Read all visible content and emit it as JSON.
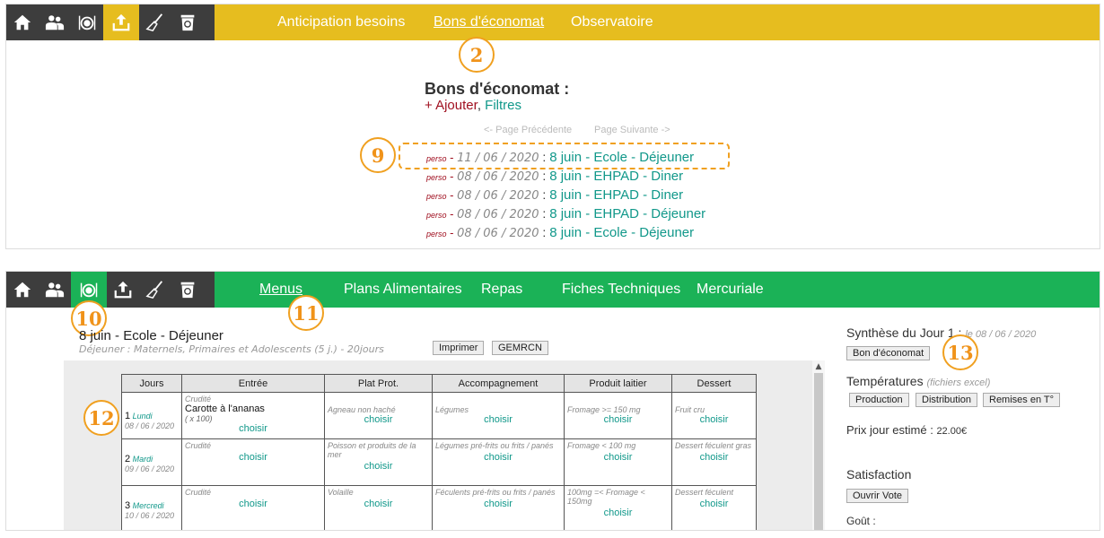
{
  "panel1": {
    "nav_links": [
      "Anticipation besoins",
      "Bons d'économat",
      "Observatoire"
    ],
    "heading": "Bons d'économat :",
    "add_label": "+ Ajouter",
    "comma": ",",
    "filters_label": "Filtres",
    "prev_page": "<- Page Précédente",
    "next_page": "Page Suivante ->",
    "bons": [
      {
        "tag": "perso",
        "date": "11 / 06 / 2020",
        "title": "8 juin - Ecole - Déjeuner"
      },
      {
        "tag": "perso",
        "date": "08 / 06 / 2020",
        "title": "8 juin - EHPAD - Diner"
      },
      {
        "tag": "perso",
        "date": "08 / 06 / 2020",
        "title": "8 juin - EHPAD - Diner"
      },
      {
        "tag": "perso",
        "date": "08 / 06 / 2020",
        "title": "8 juin - EHPAD - Déjeuner"
      },
      {
        "tag": "perso",
        "date": "08 / 06 / 2020",
        "title": "8 juin - Ecole - Déjeuner"
      }
    ],
    "badges": [
      "2",
      "9"
    ]
  },
  "panel2": {
    "nav_links": [
      "Menus",
      "Plans Alimentaires",
      "Repas",
      "Fiches Techniques",
      "Mercuriale"
    ],
    "menu_title": "8 juin - Ecole - Déjeuner",
    "menu_subtitle": "Déjeuner : Maternels, Primaires et Adolescents (5 j.) - 20jours",
    "print_label": "Imprimer",
    "gemrcn_label": "GEMRCN",
    "table": {
      "headers": [
        "Jours",
        "Entrée",
        "Plat Prot.",
        "Accompagnement",
        "Produit laitier",
        "Dessert"
      ],
      "choose": "choisir",
      "rows": [
        {
          "num": "1",
          "dayname": "Lundi",
          "date": "08 / 06 / 2020",
          "entree": {
            "cat": "Crudité",
            "dish": "Carotte à l'ananas",
            "qty": "( x 100)"
          },
          "plat": "Agneau non haché",
          "accomp": "Légumes",
          "laitier": "Fromage >= 150 mg",
          "dessert": "Fruit cru"
        },
        {
          "num": "2",
          "dayname": "Mardi",
          "date": "09 / 06 / 2020",
          "entree": {
            "cat": "Crudité"
          },
          "plat": "Poisson et produits de la mer",
          "accomp": "Légumes pré-frits ou frits / panés",
          "laitier": "Fromage < 100 mg",
          "dessert": "Dessert féculent gras"
        },
        {
          "num": "3",
          "dayname": "Mercredi",
          "date": "10 / 06 / 2020",
          "entree": {
            "cat": "Crudité"
          },
          "plat": "Volaille",
          "accomp": "Féculents pré-frits ou frits / panés",
          "laitier": "100mg =< Fromage < 150mg",
          "dessert": "Dessert féculent"
        }
      ]
    },
    "synthese_label": "Synthèse du Jour 1 :",
    "synthese_date": "le 08 / 06 / 2020",
    "bon_button": "Bon d'économat",
    "temperatures_label": "Températures",
    "fichiers_label": "(fichiers excel)",
    "temp_buttons": [
      "Production",
      "Distribution",
      "Remises en T°"
    ],
    "prix_label": "Prix jour estimé :",
    "prix_value": "22.00€",
    "satisfaction_label": "Satisfaction",
    "vote_button": "Ouvrir Vote",
    "gout_label": "Goût :",
    "badges": [
      "10",
      "11",
      "12",
      "13"
    ]
  },
  "colors": {
    "panel1_nav": "#e6bd1f",
    "panel2_nav": "#1bb257",
    "iconbar": "#3d3d3d",
    "link": "#11988a",
    "perso": "#a01020",
    "badge": "#f0931a"
  },
  "icons": [
    "home-icon",
    "users-icon",
    "plate-cutlery-icon",
    "upload-icon",
    "broom-icon",
    "recycle-bin-icon"
  ]
}
